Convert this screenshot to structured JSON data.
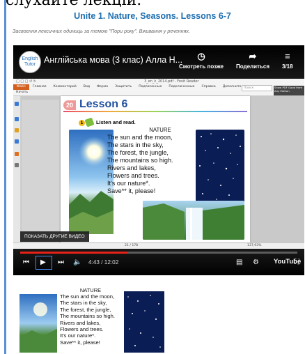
{
  "top_cut_text": "слухайте лекцій.",
  "lesson_header": {
    "title": "Unite 1. Nature, Seasons. Lessons 6-7",
    "subtitle": "Засвоєння лексичних одиниць за темою \"Пори року\". Вживання у реченнях."
  },
  "video": {
    "channel_logo": "English Tutor",
    "title": "Англійська мова (3 клас) Алла Н...",
    "watch_later": "Смотреть позже",
    "share": "Поделиться",
    "playlist_counter": "3/18",
    "more_videos": "ПОКАЗАТЬ ДРУГИЕ ВИДЕО",
    "time": "4:43 / 12:02",
    "progress": 0.39,
    "logo": "YouTube",
    "pdf_reader": {
      "app_title": "3_en_k_2014.pdf - Foxit Reader",
      "menu": [
        "Файл",
        "Главная",
        "Комментарий",
        "Вид",
        "Форма",
        "Защитить",
        "Подписанные",
        "Подключенные",
        "Справка",
        "Дополнительно"
      ],
      "doc_tab": "Начать",
      "search": "Поиск",
      "tip": "Show PDF Good from Any Edition",
      "page_counter": "21 / 178",
      "zoom": "137,93%"
    },
    "page": {
      "lesson_number": "20",
      "lesson_title": "Lesson 6",
      "task_number": "1",
      "task_text": "Listen and read.",
      "poem_title": "NATURE",
      "poem_lines": [
        "The sun and the moon,",
        "The stars in the sky,",
        "The forest, the jungle,",
        "The mountains so high.",
        "Rivers and lakes,",
        "Flowers and trees.",
        "It's our nature*.",
        "Save** it, please!"
      ]
    }
  },
  "excerpt": {
    "poem_title": "NATURE",
    "poem_lines": [
      "The sun and the moon,",
      "The stars in the sky,",
      "The forest, the jungle,",
      "The mountains so high.",
      "Rivers and lakes,",
      "Flowers and trees.",
      "It's our nature*.",
      "Save** it, please!"
    ]
  },
  "icons": [
    "clock-icon",
    "share-arrow-icon",
    "playlist-icon",
    "skip-back-icon",
    "play-icon",
    "skip-next-icon",
    "volume-icon",
    "subtitles-icon",
    "settings-gear-icon",
    "fullscreen-icon"
  ]
}
